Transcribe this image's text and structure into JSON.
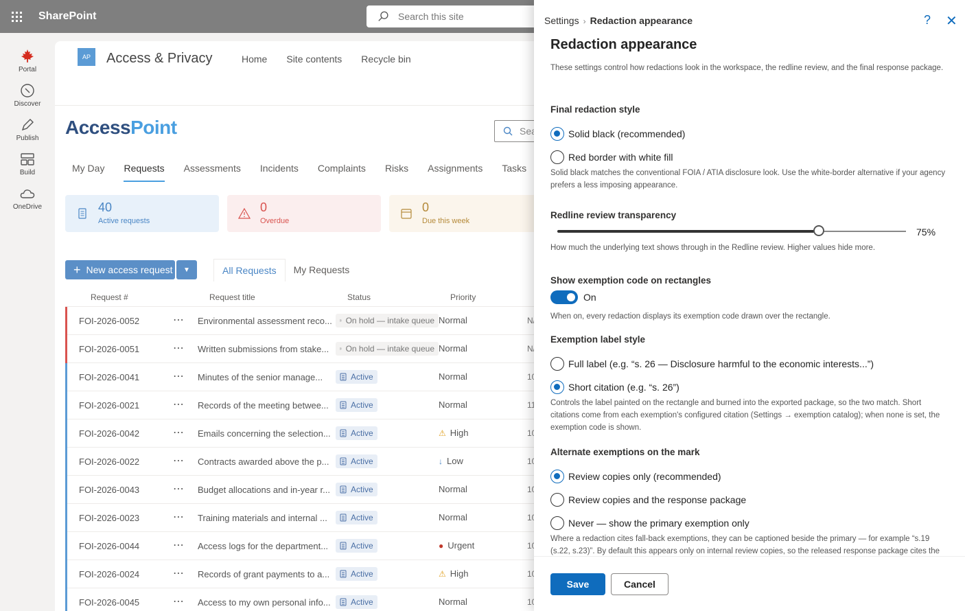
{
  "suite": {
    "app_name": "SharePoint",
    "search_placeholder": "Search this site"
  },
  "rail": {
    "items": [
      {
        "label": "Portal",
        "icon": "maple-leaf-icon"
      },
      {
        "label": "Discover",
        "icon": "compass-icon"
      },
      {
        "label": "Publish",
        "icon": "pen-icon"
      },
      {
        "label": "Build",
        "icon": "build-icon"
      },
      {
        "label": "OneDrive",
        "icon": "cloud-icon"
      }
    ]
  },
  "site": {
    "logo_initials": "AP",
    "name": "Access & Privacy",
    "nav": [
      "Home",
      "Site contents",
      "Recycle bin"
    ]
  },
  "app": {
    "brand_part1": "Access",
    "brand_part2": "Point",
    "search_placeholder": "Sea",
    "tabs": [
      "My Day",
      "Requests",
      "Assessments",
      "Incidents",
      "Complaints",
      "Risks",
      "Assignments",
      "Tasks"
    ],
    "active_tab": "Requests",
    "kpis": [
      {
        "value": "40",
        "label": "Active requests",
        "color": "#4a86c5",
        "bg": "#e8f1fa"
      },
      {
        "value": "0",
        "label": "Overdue",
        "color": "#d9534f",
        "bg": "#fbeeee"
      },
      {
        "value": "0",
        "label": "Due this week",
        "color": "#b58a3a",
        "bg": "#fbf5ec"
      }
    ],
    "new_button_label": "New access request",
    "view_tabs": [
      "All Requests",
      "My Requests"
    ],
    "columns": [
      "Request #",
      "Request title",
      "Status",
      "Priority"
    ],
    "rows": [
      {
        "id": "FOI-2026-0052",
        "title": "Environmental assessment reco...",
        "status": "On hold — intake queue",
        "status_kind": "hold",
        "priority": "Normal",
        "prio_icon": "",
        "trail": "N/",
        "bar": "#d9534f"
      },
      {
        "id": "FOI-2026-0051",
        "title": "Written submissions from stake...",
        "status": "On hold — intake queue",
        "status_kind": "hold",
        "priority": "Normal",
        "prio_icon": "",
        "trail": "N/",
        "bar": "#d9534f"
      },
      {
        "id": "FOI-2026-0041",
        "title": "Minutes of the senior manage...",
        "status": "Active",
        "status_kind": "active",
        "priority": "Normal",
        "prio_icon": "",
        "trail": "10",
        "bar": "#5b9bd5"
      },
      {
        "id": "FOI-2026-0021",
        "title": "Records of the meeting betwee...",
        "status": "Active",
        "status_kind": "active",
        "priority": "Normal",
        "prio_icon": "",
        "trail": "11",
        "bar": "#5b9bd5"
      },
      {
        "id": "FOI-2026-0042",
        "title": "Emails concerning the selection...",
        "status": "Active",
        "status_kind": "active",
        "priority": "High",
        "prio_icon": "warning",
        "trail": "10",
        "bar": "#5b9bd5"
      },
      {
        "id": "FOI-2026-0022",
        "title": "Contracts awarded above the p...",
        "status": "Active",
        "status_kind": "active",
        "priority": "Low",
        "prio_icon": "down",
        "trail": "10",
        "bar": "#5b9bd5"
      },
      {
        "id": "FOI-2026-0043",
        "title": "Budget allocations and in-year r...",
        "status": "Active",
        "status_kind": "active",
        "priority": "Normal",
        "prio_icon": "",
        "trail": "10",
        "bar": "#5b9bd5"
      },
      {
        "id": "FOI-2026-0023",
        "title": "Training materials and internal ...",
        "status": "Active",
        "status_kind": "active",
        "priority": "Normal",
        "prio_icon": "",
        "trail": "10",
        "bar": "#5b9bd5"
      },
      {
        "id": "FOI-2026-0044",
        "title": "Access logs for the department...",
        "status": "Active",
        "status_kind": "active",
        "priority": "Urgent",
        "prio_icon": "urgent",
        "trail": "10",
        "bar": "#5b9bd5"
      },
      {
        "id": "FOI-2026-0024",
        "title": "Records of grant payments to a...",
        "status": "Active",
        "status_kind": "active",
        "priority": "High",
        "prio_icon": "warning",
        "trail": "10",
        "bar": "#5b9bd5"
      },
      {
        "id": "FOI-2026-0045",
        "title": "Access to my own personal info...",
        "status": "Active",
        "status_kind": "active",
        "priority": "Normal",
        "prio_icon": "",
        "trail": "10",
        "bar": "#5b9bd5"
      }
    ]
  },
  "panel": {
    "breadcrumb_root": "Settings",
    "breadcrumb_current": "Redaction appearance",
    "title": "Redaction appearance",
    "intro": "These settings control how redactions look in the workspace, the redline review, and the final response package.",
    "final_style": {
      "heading": "Final redaction style",
      "options": [
        "Solid black (recommended)",
        "Red border with white fill"
      ],
      "selected": 0,
      "help": "Solid black matches the conventional FOIA / ATIA disclosure look. Use the white-border alternative if your agency prefers a less imposing appearance."
    },
    "transparency": {
      "heading": "Redline review transparency",
      "value_label": "75%",
      "value": 0.75,
      "help": "How much the underlying text shows through in the Redline review. Higher values hide more."
    },
    "show_code": {
      "heading": "Show exemption code on rectangles",
      "state_label": "On",
      "help": "When on, every redaction displays its exemption code drawn over the rectangle."
    },
    "label_style": {
      "heading": "Exemption label style",
      "options": [
        "Full label (e.g. “s. 26 — Disclosure harmful to the economic interests...”)",
        "Short citation (e.g. “s. 26”)"
      ],
      "selected": 1,
      "help": "Controls the label painted on the rectangle and burned into the exported package, so the two match. Short citations come from each exemption's configured citation (Settings → exemption catalog); when none is set, the exemption code is shown."
    },
    "alternate": {
      "heading": "Alternate exemptions on the mark",
      "options": [
        "Review copies only (recommended)",
        "Review copies and the response package",
        "Never — show the primary exemption only"
      ],
      "selected": 0,
      "help": "Where a redaction cites fall-back exemptions, they can be captioned beside the primary — for example “s.19 (s.22, s.23)”. By default this appears only on internal review copies, so the released response package cites the"
    },
    "save_label": "Save",
    "cancel_label": "Cancel",
    "accent": "#0f6cbd"
  }
}
